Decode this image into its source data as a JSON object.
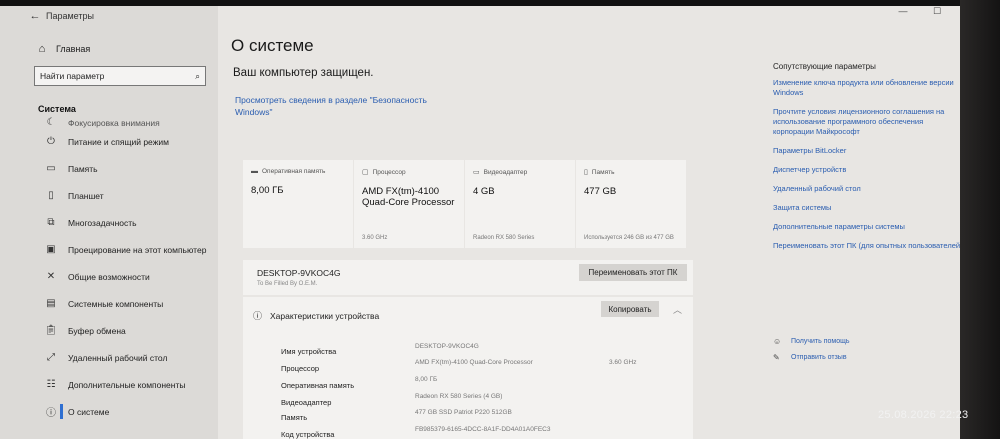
{
  "window": {
    "title": "Параметры"
  },
  "sidebar": {
    "home_label": "Главная",
    "search_placeholder": "Найти параметр",
    "section_title": "Система",
    "items": [
      {
        "label": "Фокусировка внимания",
        "icon": "moon-icon"
      },
      {
        "label": "Питание и спящий режим",
        "icon": "power-icon"
      },
      {
        "label": "Память",
        "icon": "storage-icon"
      },
      {
        "label": "Планшет",
        "icon": "tablet-icon"
      },
      {
        "label": "Многозадачность",
        "icon": "multitasking-icon"
      },
      {
        "label": "Проецирование на этот компьютер",
        "icon": "projecting-icon"
      },
      {
        "label": "Общие возможности",
        "icon": "shared-experiences-icon"
      },
      {
        "label": "Системные компоненты",
        "icon": "system-components-icon"
      },
      {
        "label": "Буфер обмена",
        "icon": "clipboard-icon"
      },
      {
        "label": "Удаленный рабочий стол",
        "icon": "remote-desktop-icon"
      },
      {
        "label": "Дополнительные компоненты",
        "icon": "optional-features-icon"
      },
      {
        "label": "О системе",
        "icon": "info-icon"
      }
    ]
  },
  "main": {
    "title": "О системе",
    "protected_text": "Ваш компьютер защищен.",
    "security_link": "Просмотреть сведения в разделе \"Безопасность Windows\"",
    "cards": [
      {
        "label": "Оперативная память",
        "value": "8,00 ГБ",
        "sub": ""
      },
      {
        "label": "Процессор",
        "value": "AMD FX(tm)-4100 Quad-Core Processor",
        "sub": "3.60 GHz"
      },
      {
        "label": "Видеоадаптер",
        "value": "4 GB",
        "sub": "Radeon RX 580 Series"
      },
      {
        "label": "Память",
        "value": "477 GB",
        "sub": "Используется 246 GB из 477 GB"
      }
    ],
    "pc_name": "DESKTOP-9VKOC4G",
    "pc_subtitle": "To Be Filled By O.E.M.",
    "rename_button": "Переименовать этот ПК",
    "specs_title": "Характеристики устройства",
    "copy_button": "Копировать",
    "specs": [
      {
        "label": "Имя устройства",
        "value": "DESKTOP-9VKOC4G"
      },
      {
        "label": "Процессор",
        "value": "AMD FX(tm)-4100 Quad-Core Processor",
        "extra": "3.60 GHz"
      },
      {
        "label": "Оперативная память",
        "value": "8,00 ГБ"
      },
      {
        "label": "Видеоадаптер",
        "value": "Radeon RX 580 Series (4 GB)"
      },
      {
        "label": "Память",
        "value": "477 GB SSD Patriot P220 512GB"
      },
      {
        "label": "Код устройства",
        "value": "FB985379-6165-4DCC-8A1F-DD4A01A0FEC3"
      }
    ]
  },
  "related": {
    "title": "Сопутствующие параметры",
    "links": [
      "Изменение ключа продукта или обновление версии Windows",
      "Прочтите условия лицензионного соглашения на использование программного обеспечения корпорации Майкрософт",
      "Параметры BitLocker",
      "Диспетчер устройств",
      "Удаленный рабочий стол",
      "Защита системы",
      "Дополнительные параметры системы",
      "Переименовать этот ПК (для опытных пользователей)"
    ],
    "help": "Получить помощь",
    "feedback": "Отправить отзыв"
  },
  "photo_timestamp": "25.08.2026 22:23"
}
